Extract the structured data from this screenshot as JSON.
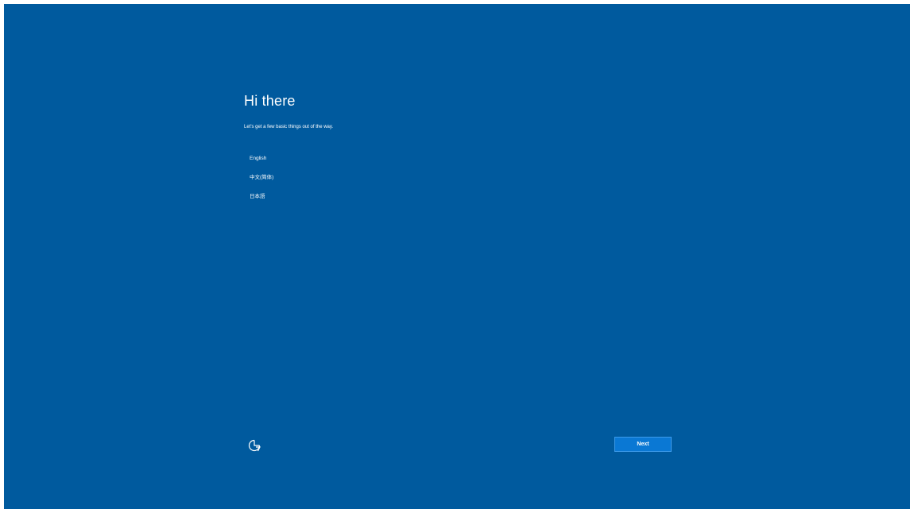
{
  "setup": {
    "title": "Hi there",
    "subtitle": "Let's get a few basic things out of the way.",
    "languages": [
      {
        "label": "English"
      },
      {
        "label": "中文(简体)"
      },
      {
        "label": "日本語"
      }
    ]
  },
  "footer": {
    "accessibility_icon": "ease-of-access-icon",
    "next_label": "Next"
  },
  "colors": {
    "background": "#005a9e",
    "button": "#0a78d4",
    "text": "#ffffff"
  }
}
